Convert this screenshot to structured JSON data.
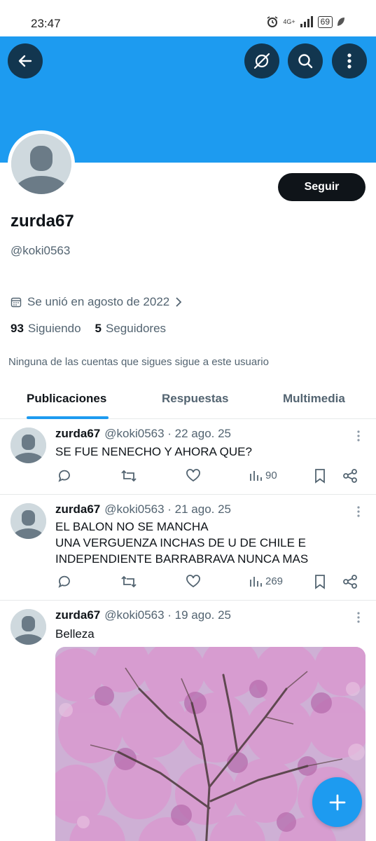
{
  "status_bar": {
    "time": "23:47",
    "network": "4G+",
    "battery": "69"
  },
  "colors": {
    "banner": "#1d9bf0",
    "accent": "#1d9bf0",
    "follow_button": "#0f1419"
  },
  "header": {
    "back_icon": "arrow-left-icon",
    "grok_icon": "grok-icon",
    "search_icon": "search-icon",
    "more_icon": "more-vertical-icon"
  },
  "profile": {
    "display_name": "zurda67",
    "handle": "@koki0563",
    "follow_label": "Seguir",
    "joined": "Se unió en agosto de 2022",
    "following_count": "93",
    "following_label": "Siguiendo",
    "followers_count": "5",
    "followers_label": "Seguidores",
    "not_followed_note": "Ninguna de las cuentas que sigues sigue a este usuario"
  },
  "tabs": [
    {
      "label": "Publicaciones",
      "active": true
    },
    {
      "label": "Respuestas",
      "active": false
    },
    {
      "label": "Multimedia",
      "active": false
    }
  ],
  "posts": [
    {
      "name": "zurda67",
      "meta": "@koki0563 · 22 ago. 25",
      "text": "SE FUE NENECHO Y AHORA QUE?",
      "views": "90"
    },
    {
      "name": "zurda67",
      "meta": "@koki0563 · 21 ago. 25",
      "text": "EL BALON NO SE MANCHA\nUNA VERGUENZA INCHAS DE U DE CHILE E\nINDEPENDIENTE BARRABRAVA NUNCA MAS",
      "views": "269"
    },
    {
      "name": "zurda67",
      "meta": "@koki0563 · 19 ago. 25",
      "text": "Belleza",
      "image": "pink-flowering-tree-photo"
    }
  ],
  "fab": {
    "icon": "plus-icon"
  }
}
